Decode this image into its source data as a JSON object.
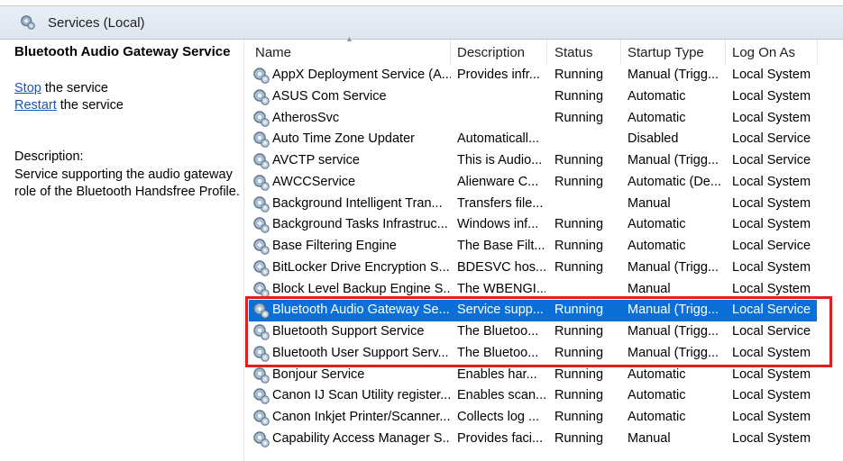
{
  "header": {
    "title": "Services (Local)",
    "icon": "services-gear-icon"
  },
  "left_pane": {
    "service_title": "Bluetooth Audio Gateway Service",
    "stop_link": "Stop",
    "stop_suffix": " the service",
    "restart_link": "Restart",
    "restart_suffix": " the service",
    "description_label": "Description:",
    "description_text": "Service supporting the audio gateway role of the Bluetooth Handsfree Profile."
  },
  "columns": {
    "name": "Name",
    "description": "Description",
    "status": "Status",
    "startup_type": "Startup Type",
    "log_on_as": "Log On As"
  },
  "rows": [
    {
      "name": "AppX Deployment Service (A...",
      "desc": "Provides infr...",
      "status": "Running",
      "type": "Manual (Trigg...",
      "logon": "Local System"
    },
    {
      "name": "ASUS Com Service",
      "desc": "",
      "status": "Running",
      "type": "Automatic",
      "logon": "Local System"
    },
    {
      "name": "AtherosSvc",
      "desc": "",
      "status": "Running",
      "type": "Automatic",
      "logon": "Local System"
    },
    {
      "name": "Auto Time Zone Updater",
      "desc": "Automaticall...",
      "status": "",
      "type": "Disabled",
      "logon": "Local Service"
    },
    {
      "name": "AVCTP service",
      "desc": "This is Audio...",
      "status": "Running",
      "type": "Manual (Trigg...",
      "logon": "Local Service"
    },
    {
      "name": "AWCCService",
      "desc": "Alienware C...",
      "status": "Running",
      "type": "Automatic (De...",
      "logon": "Local System"
    },
    {
      "name": "Background Intelligent Tran...",
      "desc": "Transfers file...",
      "status": "",
      "type": "Manual",
      "logon": "Local System"
    },
    {
      "name": "Background Tasks Infrastruc...",
      "desc": "Windows inf...",
      "status": "Running",
      "type": "Automatic",
      "logon": "Local System"
    },
    {
      "name": "Base Filtering Engine",
      "desc": "The Base Filt...",
      "status": "Running",
      "type": "Automatic",
      "logon": "Local Service"
    },
    {
      "name": "BitLocker Drive Encryption S...",
      "desc": "BDESVC hos...",
      "status": "Running",
      "type": "Manual (Trigg...",
      "logon": "Local System"
    },
    {
      "name": "Block Level Backup Engine S...",
      "desc": "The WBENGI...",
      "status": "",
      "type": "Manual",
      "logon": "Local System"
    },
    {
      "name": "Bluetooth Audio Gateway Se...",
      "desc": "Service supp...",
      "status": "Running",
      "type": "Manual (Trigg...",
      "logon": "Local Service",
      "selected": true
    },
    {
      "name": "Bluetooth Support Service",
      "desc": "The Bluetoo...",
      "status": "Running",
      "type": "Manual (Trigg...",
      "logon": "Local Service"
    },
    {
      "name": "Bluetooth User Support Serv...",
      "desc": "The Bluetoo...",
      "status": "Running",
      "type": "Manual (Trigg...",
      "logon": "Local System"
    },
    {
      "name": "Bonjour Service",
      "desc": "Enables har...",
      "status": "Running",
      "type": "Automatic",
      "logon": "Local System"
    },
    {
      "name": "Canon IJ Scan Utility register...",
      "desc": "Enables scan...",
      "status": "Running",
      "type": "Automatic",
      "logon": "Local System"
    },
    {
      "name": "Canon Inkjet Printer/Scanner...",
      "desc": "Collects log ...",
      "status": "Running",
      "type": "Automatic",
      "logon": "Local System"
    },
    {
      "name": "Capability Access Manager S...",
      "desc": "Provides faci...",
      "status": "Running",
      "type": "Manual",
      "logon": "Local System"
    }
  ],
  "colors": {
    "selection": "#0a6fd6",
    "highlight_box": "#e02020",
    "link": "#1a56b8"
  }
}
